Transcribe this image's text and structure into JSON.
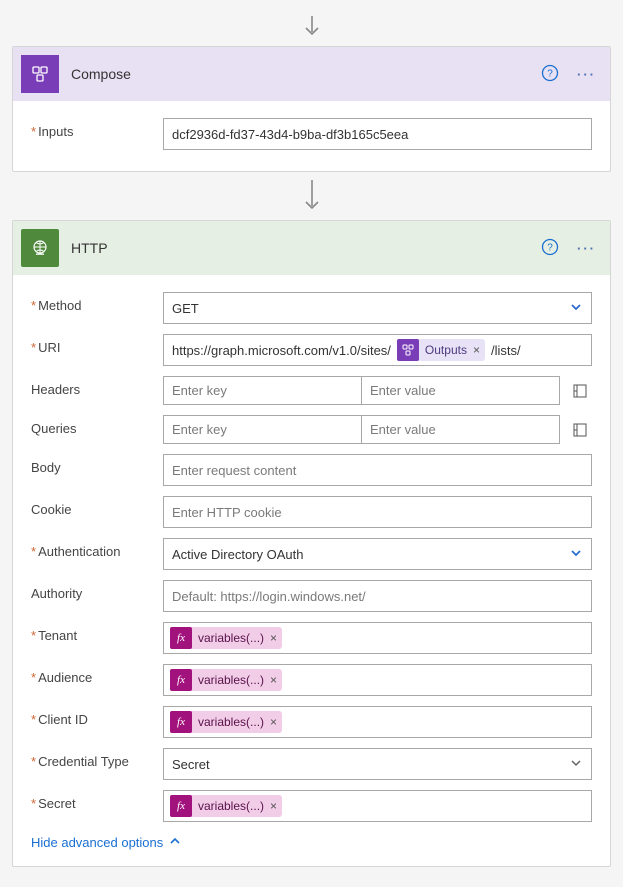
{
  "connector_icon": "↓",
  "compose": {
    "title": "Compose",
    "inputs_label": "Inputs",
    "inputs_value": "dcf2936d-fd37-43d4-b9ba-df3b165c5eea"
  },
  "http": {
    "title": "HTTP",
    "labels": {
      "method": "Method",
      "uri": "URI",
      "headers": "Headers",
      "queries": "Queries",
      "body": "Body",
      "cookie": "Cookie",
      "authentication": "Authentication",
      "authority": "Authority",
      "tenant": "Tenant",
      "audience": "Audience",
      "client_id": "Client ID",
      "credential_type": "Credential Type",
      "secret": "Secret"
    },
    "method_value": "GET",
    "uri_prefix": "https://graph.microsoft.com/v1.0/sites/",
    "uri_token_label": "Outputs",
    "uri_suffix": "/lists/",
    "kv_key_placeholder": "Enter key",
    "kv_value_placeholder": "Enter value",
    "body_placeholder": "Enter request content",
    "cookie_placeholder": "Enter HTTP cookie",
    "auth_value": "Active Directory OAuth",
    "authority_placeholder": "Default: https://login.windows.net/",
    "fx_token_label": "variables(...)",
    "credential_value": "Secret",
    "hide_link": "Hide advanced options"
  }
}
